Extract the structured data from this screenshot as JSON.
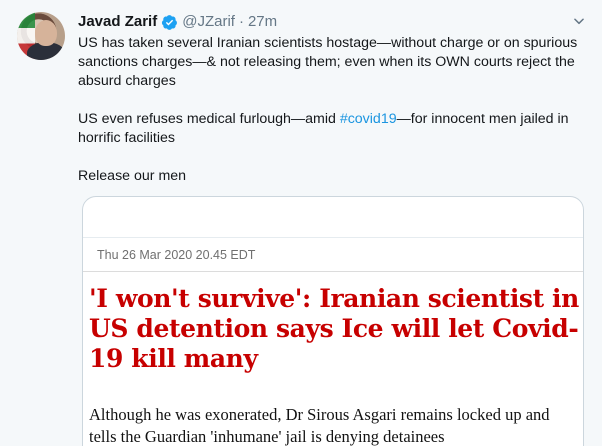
{
  "tweet": {
    "author_name": "Javad Zarif",
    "handle": "@JZarif",
    "separator": "·",
    "time": "27m",
    "paragraphs": {
      "p1": "US has taken several Iranian scientists hostage—without charge or on spurious sanctions charges—& not releasing them; even when its OWN courts reject the absurd charges",
      "p2_before": "US even refuses medical furlough—amid ",
      "p2_hashtag": "#covid19",
      "p2_after": "—for innocent men jailed in horrific facilities",
      "p3": "Release our men"
    }
  },
  "card": {
    "date": "Thu 26 Mar 2020 20.45 EDT",
    "headline": "'I won't survive': Iranian scientist in US detention says Ice will let Covid-19 kill many",
    "standfirst": "Although he was exonerated, Dr Sirous Asgari remains locked up and tells the Guardian 'inhumane' jail is denying detainees"
  },
  "icons": {
    "verified": "verified-badge-icon",
    "menu": "chevron-down-icon"
  },
  "colors": {
    "link": "#1b95e0",
    "headline": "#c70000",
    "secondary_text": "#657786"
  }
}
